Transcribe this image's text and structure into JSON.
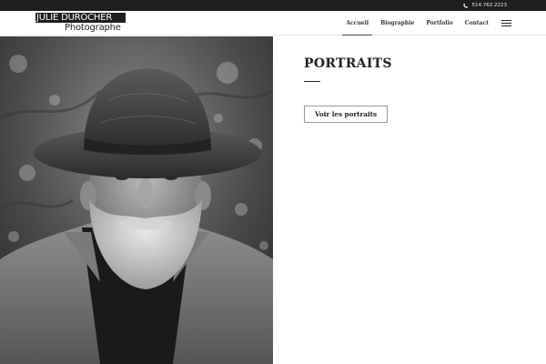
{
  "topbar": {
    "phone": "514.762.2223",
    "phone_icon": "phone-icon"
  },
  "header": {
    "logo": {
      "line1": "JULIE DUROCHER",
      "line2": "Photographe"
    },
    "nav": [
      {
        "label": "Accueil",
        "active": true
      },
      {
        "label": "Biographie",
        "active": false
      },
      {
        "label": "Portfolio",
        "active": false
      },
      {
        "label": "Contact",
        "active": false
      }
    ],
    "menu_icon": "hamburger-menu-icon"
  },
  "hero": {
    "image": "black-and-white portrait photo"
  },
  "main": {
    "title": "PORTRAITS",
    "button_label": "Voir les portraits"
  }
}
